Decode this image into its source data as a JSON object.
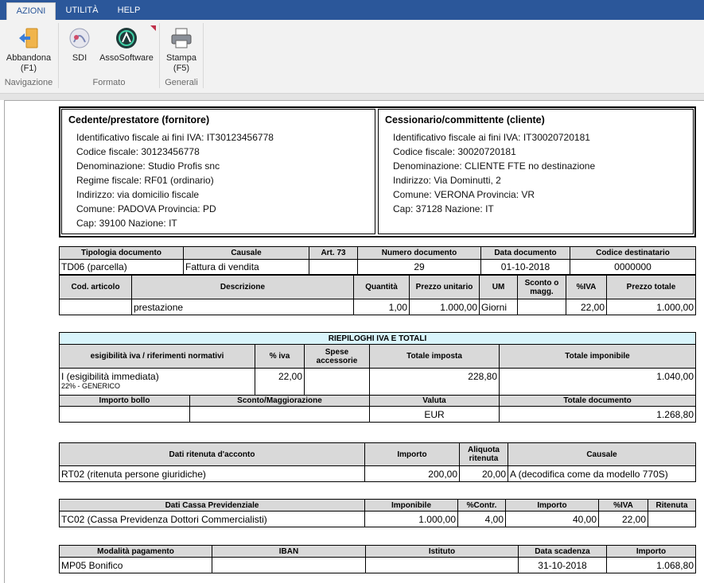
{
  "tabs": [
    "AZIONI",
    "UTILITÀ",
    "HELP"
  ],
  "ribbon": {
    "abbandona_label": "Abbandona",
    "abbandona_key": "(F1)",
    "sdi_label": "SDI",
    "assosoftware_label": "AssoSoftware",
    "stampa_label": "Stampa",
    "stampa_key": "(F5)",
    "group_navigazione": "Navigazione",
    "group_formato": "Formato",
    "group_generali": "Generali"
  },
  "cedente": {
    "title": "Cedente/prestatore (fornitore)",
    "lines": [
      "Identificativo fiscale ai fini IVA: IT30123456778",
      "Codice fiscale: 30123456778",
      "Denominazione: Studio Profis snc",
      "Regime fiscale: RF01 (ordinario)",
      "Indirizzo: via domicilio fiscale",
      "Comune: PADOVA Provincia: PD",
      "Cap: 39100 Nazione: IT"
    ]
  },
  "cessionario": {
    "title": "Cessionario/committente (cliente)",
    "lines": [
      "Identificativo fiscale ai fini IVA: IT30020720181",
      "Codice fiscale: 30020720181",
      "Denominazione: CLIENTE FTE no destinazione",
      "Indirizzo: Via Dominutti, 2",
      "Comune: VERONA Provincia: VR",
      "Cap: 37128 Nazione: IT"
    ]
  },
  "doc": {
    "headers": [
      "Tipologia documento",
      "Causale",
      "Art. 73",
      "Numero documento",
      "Data documento",
      "Codice destinatario"
    ],
    "values": [
      "TD06 (parcella)",
      "Fattura di vendita",
      "",
      "29",
      "01-10-2018",
      "0000000"
    ]
  },
  "lines_table": {
    "headers": [
      "Cod. articolo",
      "Descrizione",
      "Quantità",
      "Prezzo unitario",
      "UM",
      "Sconto o magg.",
      "%IVA",
      "Prezzo totale"
    ],
    "values": [
      "",
      "prestazione",
      "1,00",
      "1.000,00",
      "Giorni",
      "",
      "22,00",
      "1.000,00"
    ]
  },
  "riepilogo": {
    "title": "RIEPILOGHI IVA E TOTALI",
    "headers": [
      "esigibilità iva / riferimenti normativi",
      "% iva",
      "Spese accessorie",
      "Totale imposta",
      "Totale imponibile"
    ],
    "esigibilita": "I (esigibilità immediata)",
    "esigibilita_note": "22% - GENERICO",
    "perc_iva": "22,00",
    "spese": "",
    "totale_imposta": "228,80",
    "totale_imponibile": "1.040,00",
    "headers2": [
      "Importo bollo",
      "Sconto/Maggiorazione",
      "Valuta",
      "Totale documento"
    ],
    "bollo": "",
    "sconto": "",
    "valuta": "EUR",
    "totale_documento": "1.268,80"
  },
  "ritenuta": {
    "headers": [
      "Dati ritenuta d'acconto",
      "Importo",
      "Aliquota ritenuta",
      "Causale"
    ],
    "values": [
      "RT02 (ritenuta persone giuridiche)",
      "200,00",
      "20,00",
      "A (decodifica come da modello 770S)"
    ]
  },
  "cassa": {
    "headers": [
      "Dati Cassa Previdenziale",
      "Imponibile",
      "%Contr.",
      "Importo",
      "%IVA",
      "Ritenuta"
    ],
    "values": [
      "TC02 (Cassa Previdenza Dottori Commercialisti)",
      "1.000,00",
      "4,00",
      "40,00",
      "22,00",
      ""
    ]
  },
  "pagamento": {
    "headers": [
      "Modalità pagamento",
      "IBAN",
      "Istituto",
      "Data scadenza",
      "Importo"
    ],
    "values": [
      "MP05 Bonifico",
      "",
      "",
      "31-10-2018",
      "1.068,80"
    ]
  },
  "colors": {
    "ribbon_tab_bar": "#2b579a",
    "header_cell": "#d9d9d9",
    "summary_title": "#d9f4fb"
  }
}
